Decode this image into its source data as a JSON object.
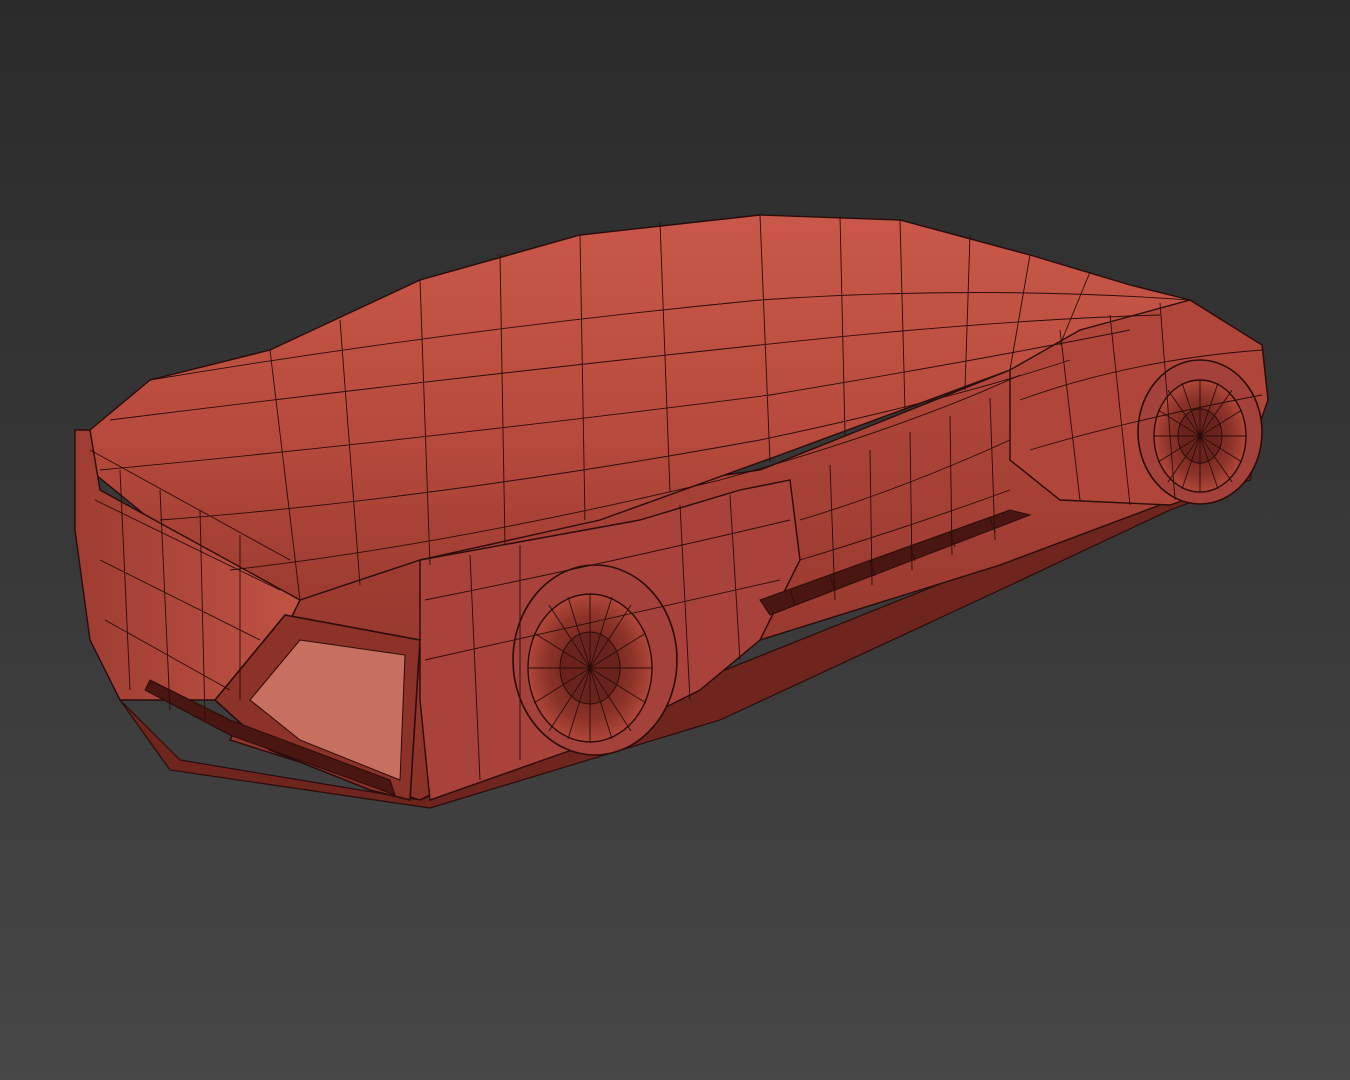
{
  "scene": {
    "background_top": "#2b2b2b",
    "background_bottom": "#474747",
    "model": {
      "subject": "car-model-wireframe",
      "shading": "shaded-with-edged-faces",
      "body_color": "#b5473a",
      "body_highlight": "#cf5c4c",
      "body_shadow": "#7a2a22",
      "edge_color": "#2a0c0a"
    }
  }
}
